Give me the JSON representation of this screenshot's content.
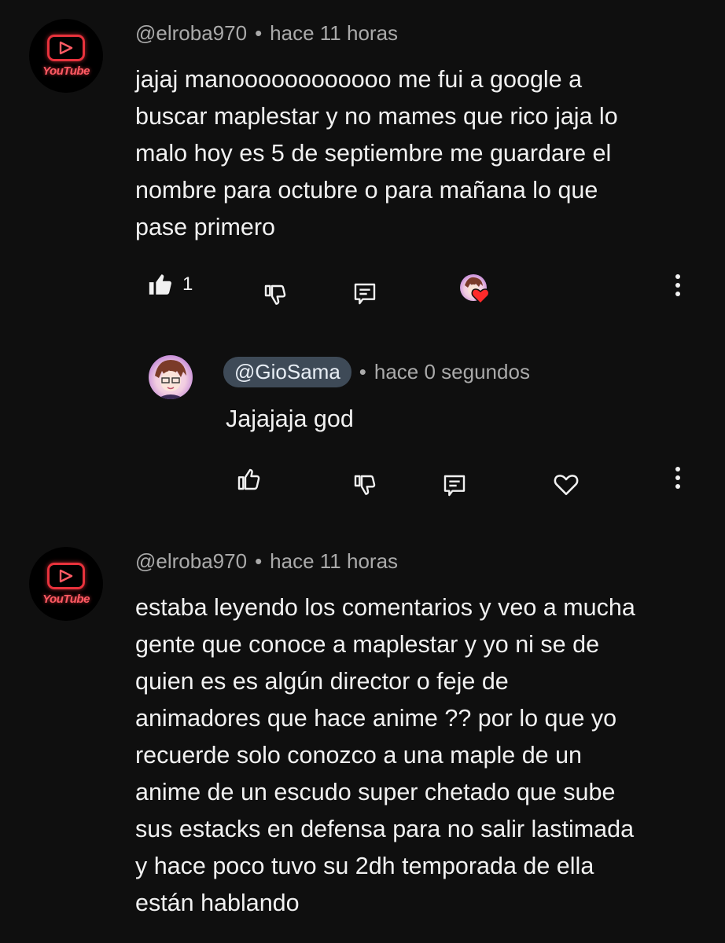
{
  "comments": [
    {
      "handle": "@elroba970",
      "time": "hace 11 horas",
      "avatar_text": "YouTube",
      "lines": [
        "jajaj manoooooooooooo me fui a google a",
        "buscar maplestar y no mames que rico jaja lo",
        "malo hoy es 5 de septiembre me guardare el",
        "nombre para octubre o para mañana lo que",
        "pase primero"
      ],
      "like_count": "1"
    },
    {
      "handle": "@elroba970",
      "time": "hace 11 horas",
      "avatar_text": "YouTube",
      "lines": [
        "estaba leyendo los comentarios y veo a mucha",
        "gente que conoce a maplestar y yo ni se de",
        "quien es es algún director o feje de",
        "animadores que hace anime ?? por lo que yo",
        "recuerde solo conozco a una maple de un",
        "anime de un escudo super chetado que sube",
        "sus estacks en defensa para no salir lastimada",
        "y hace poco tuvo su 2dh temporada de ella",
        "están hablando"
      ]
    }
  ],
  "reply": {
    "handle": "@GioSama",
    "time": "hace 0 segundos",
    "text": "Jajajaja god"
  },
  "separator": "•",
  "colors": {
    "accent_red": "#e8323c",
    "heart": "#ff2a2a",
    "chip": "#3e4a57"
  }
}
